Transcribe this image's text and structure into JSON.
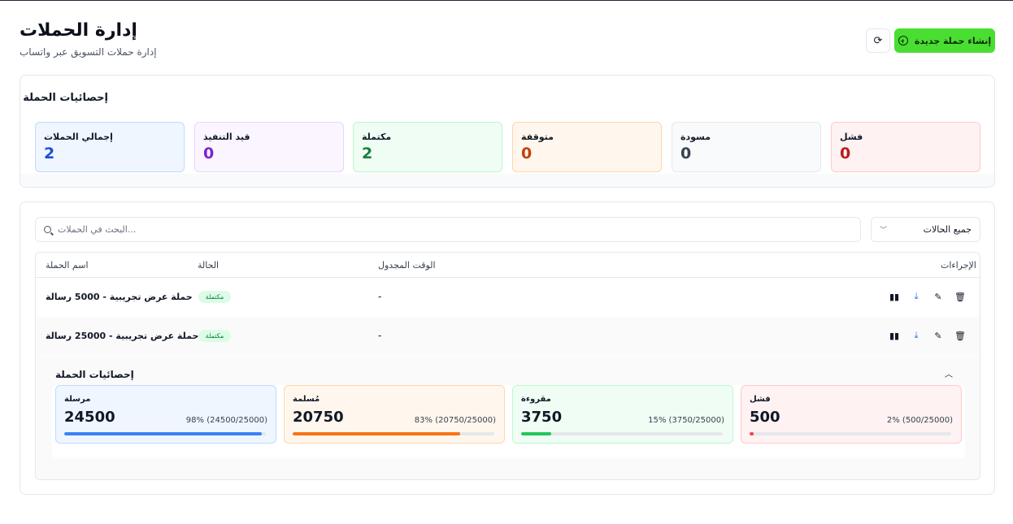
{
  "header": {
    "title": "إدارة الحملات",
    "subtitle": "إدارة حملات التسويق عبر واتساب",
    "create_button": "إنشاء حملة جديدة",
    "refresh_icon": "refresh-icon",
    "create_icon": "plus-circle-icon"
  },
  "overview": {
    "title": "إحصائيات الحملة",
    "stats": [
      {
        "label": "إجمالي الحملات",
        "value": "2",
        "color": "#1d4ed8",
        "bg": "#eff6ff",
        "border": "#bfdbfe"
      },
      {
        "label": "قيد التنفيذ",
        "value": "0",
        "color": "#7e22ce",
        "bg": "#faf5ff",
        "border": "#e9d5ff"
      },
      {
        "label": "مكتملة",
        "value": "2",
        "color": "#15803d",
        "bg": "#f0fdf4",
        "border": "#bbf7d0"
      },
      {
        "label": "متوقفة",
        "value": "0",
        "color": "#c2410c",
        "bg": "#fff7ed",
        "border": "#fed7aa"
      },
      {
        "label": "مسودة",
        "value": "0",
        "color": "#374151",
        "bg": "#f9fafb",
        "border": "#e5e7eb"
      },
      {
        "label": "فشل",
        "value": "0",
        "color": "#b91c1c",
        "bg": "#fef2f2",
        "border": "#fecaca"
      }
    ]
  },
  "filters": {
    "search_placeholder": "البحث في الحملات...",
    "status_select": "جميع الحالات"
  },
  "table": {
    "columns": {
      "name": "اسم الحملة",
      "status": "الحالة",
      "scheduled": "الوقت المجدول",
      "actions": "الإجراءات"
    },
    "rows": [
      {
        "name": "حملة عرض تجريبية - 5000 رسالة",
        "status": "مكتملة",
        "scheduled": "-"
      },
      {
        "name": "حملة عرض تجريبية - 25000 رسالة",
        "status": "مكتملة",
        "scheduled": "-"
      }
    ]
  },
  "campaign_stats": {
    "title": "إحصائيات الحملة",
    "metrics": [
      {
        "label": "مرسلة",
        "value": "24500",
        "detail": "98% (24500/25000)",
        "progress": 0.98,
        "color": "#3b82f6",
        "bg": "#eff6ff",
        "border": "#bfdbfe"
      },
      {
        "label": "مُسلمة",
        "value": "20750",
        "detail": "83% (20750/25000)",
        "progress": 0.83,
        "color": "#f97316",
        "bg": "#fff7ed",
        "border": "#fed7aa"
      },
      {
        "label": "مقروءة",
        "value": "3750",
        "detail": "15% (3750/25000)",
        "progress": 0.15,
        "color": "#22c55e",
        "bg": "#f0fdf4",
        "border": "#bbf7d0"
      },
      {
        "label": "فشل",
        "value": "500",
        "detail": "2% (500/25000)",
        "progress": 0.02,
        "color": "#ef4444",
        "bg": "#fef2f2",
        "border": "#fecaca"
      }
    ]
  }
}
